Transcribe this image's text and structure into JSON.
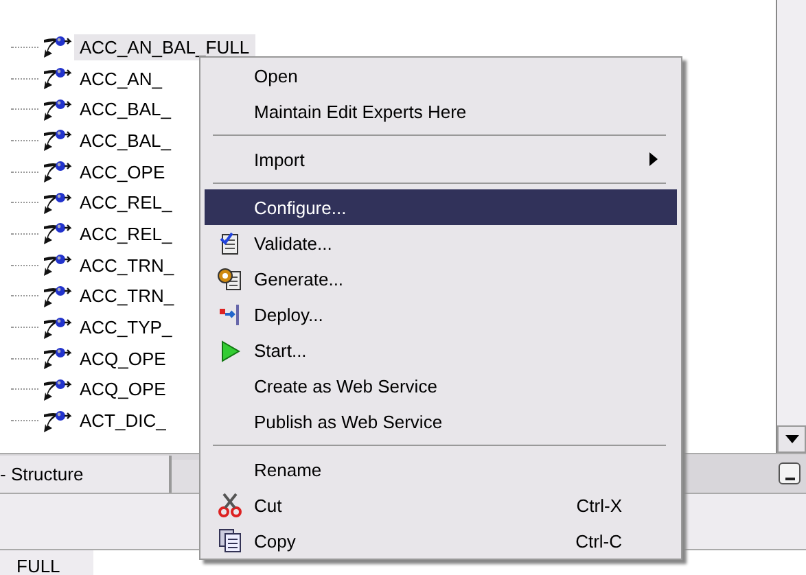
{
  "tree": {
    "items": [
      {
        "label": "ACC_AN_BAL_FULL",
        "selected": true
      },
      {
        "label": "ACC_AN_",
        "selected": false
      },
      {
        "label": "ACC_BAL_",
        "selected": false
      },
      {
        "label": "ACC_BAL_",
        "selected": false
      },
      {
        "label": "ACC_OPE",
        "selected": false
      },
      {
        "label": "ACC_REL_",
        "selected": false
      },
      {
        "label": "ACC_REL_",
        "selected": false
      },
      {
        "label": "ACC_TRN_",
        "selected": false
      },
      {
        "label": "ACC_TRN_",
        "selected": false
      },
      {
        "label": "ACC_TYP_",
        "selected": false
      },
      {
        "label": "ACQ_OPE",
        "selected": false
      },
      {
        "label": "ACQ_OPE",
        "selected": false
      },
      {
        "label": "ACT_DIC_",
        "selected": false
      }
    ]
  },
  "tabs": [
    {
      "label": "- Structure",
      "selected": true
    }
  ],
  "bottom_cell": "FULL",
  "context_menu": {
    "items": [
      {
        "kind": "item",
        "label": "Open",
        "selected": false
      },
      {
        "kind": "item",
        "label": "Maintain Edit Experts Here",
        "selected": false
      },
      {
        "kind": "separator"
      },
      {
        "kind": "submenu",
        "label": "Import",
        "selected": false
      },
      {
        "kind": "separator"
      },
      {
        "kind": "item",
        "label": "Configure...",
        "selected": true
      },
      {
        "kind": "item",
        "label": "Validate...",
        "selected": false
      },
      {
        "kind": "item",
        "label": "Generate...",
        "selected": false
      },
      {
        "kind": "item",
        "label": "Deploy...",
        "selected": false
      },
      {
        "kind": "item",
        "label": "Start...",
        "selected": false
      },
      {
        "kind": "item",
        "label": "Create as Web Service",
        "selected": false
      },
      {
        "kind": "item",
        "label": "Publish as Web Service",
        "selected": false
      },
      {
        "kind": "separator"
      },
      {
        "kind": "item",
        "label": "Rename",
        "selected": false
      },
      {
        "kind": "item",
        "label": "Cut",
        "shortcut": "Ctrl-X",
        "selected": false
      },
      {
        "kind": "item",
        "label": "Copy",
        "shortcut": "Ctrl-C",
        "selected": false
      }
    ]
  }
}
